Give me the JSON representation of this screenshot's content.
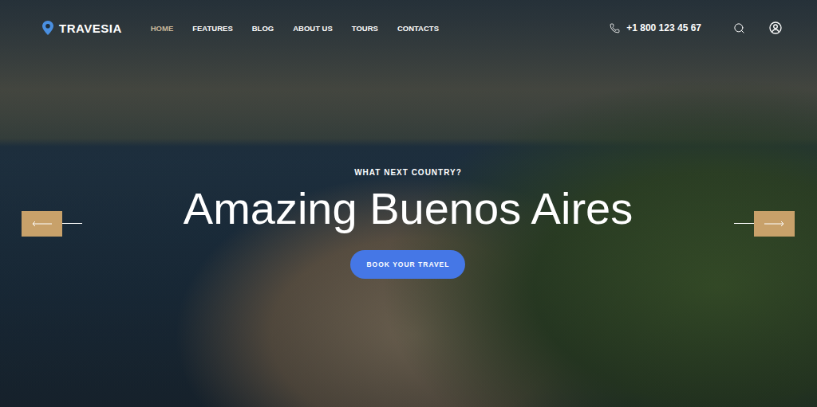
{
  "header": {
    "logo": "TRAVESIA",
    "phone": "+1 800 123 45 67"
  },
  "nav": {
    "items": [
      {
        "label": "HOME",
        "selected": true
      },
      {
        "label": "FEATURES",
        "selected": false
      },
      {
        "label": "BLOG",
        "selected": false
      },
      {
        "label": "ABOUT US",
        "selected": false
      },
      {
        "label": "TOURS",
        "selected": false
      },
      {
        "label": "CONTACTS",
        "selected": false
      }
    ]
  },
  "hero": {
    "eyebrow": "WHAT NEXT COUNTRY?",
    "title": "Amazing Buenos Aires",
    "button": "BOOK YOUR TRAVEL"
  }
}
